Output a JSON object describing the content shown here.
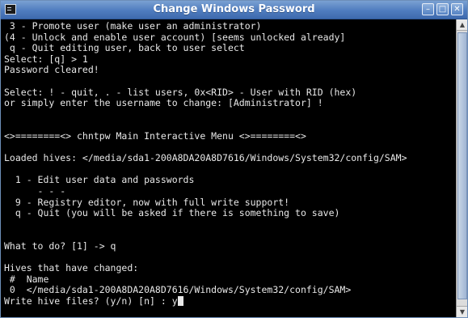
{
  "window": {
    "title": "Change Windows Password",
    "buttons": {
      "minimize": "–",
      "maximize": "□",
      "close": "✕"
    }
  },
  "terminal": {
    "lines": [
      " 3 - Promote user (make user an administrator)",
      "(4 - Unlock and enable user account) [seems unlocked already]",
      " q - Quit editing user, back to user select",
      "Select: [q] > 1",
      "Password cleared!",
      "",
      "Select: ! - quit, . - list users, 0x<RID> - User with RID (hex)",
      "or simply enter the username to change: [Administrator] !",
      "",
      "",
      "<>========<> chntpw Main Interactive Menu <>========<>",
      "",
      "Loaded hives: </media/sda1-200A8DA20A8D7616/Windows/System32/config/SAM>",
      "",
      "  1 - Edit user data and passwords",
      "      - - -",
      "  9 - Registry editor, now with full write support!",
      "  q - Quit (you will be asked if there is something to save)",
      "",
      "",
      "What to do? [1] -> q",
      "",
      "Hives that have changed:",
      " #  Name",
      " 0  </media/sda1-200A8DA20A8D7616/Windows/System32/config/SAM>",
      "Write hive files? (y/n) [n] : y"
    ]
  },
  "icons": {
    "app": "terminal-icon",
    "scroll_up": "arrow-up-icon",
    "scroll_down": "arrow-down-icon"
  }
}
